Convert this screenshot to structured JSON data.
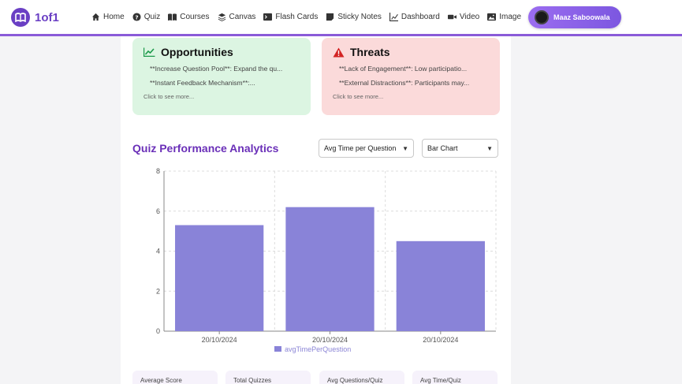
{
  "app": {
    "name": "1of1"
  },
  "nav": [
    {
      "label": "Home",
      "icon": "home-icon"
    },
    {
      "label": "Quiz",
      "icon": "question-icon"
    },
    {
      "label": "Courses",
      "icon": "book-icon"
    },
    {
      "label": "Canvas",
      "icon": "layers-icon"
    },
    {
      "label": "Flash Cards",
      "icon": "terminal-icon"
    },
    {
      "label": "Sticky Notes",
      "icon": "note-icon"
    },
    {
      "label": "Dashboard",
      "icon": "chart-icon"
    },
    {
      "label": "Video",
      "icon": "video-icon"
    },
    {
      "label": "Image",
      "icon": "image-icon"
    }
  ],
  "user": {
    "name": "Maaz Saboowala"
  },
  "swot": {
    "opportunities": {
      "title": "Opportunities",
      "items": [
        "**Increase Question Pool**: Expand the qu...",
        "**Instant Feedback Mechanism**:..."
      ],
      "more": "Click to see more..."
    },
    "threats": {
      "title": "Threats",
      "items": [
        "**Lack of Engagement**: Low participatio...",
        "**External Distractions**: Participants may..."
      ],
      "more": "Click to see more..."
    }
  },
  "analytics": {
    "title": "Quiz Performance Analytics",
    "metric_select": "Avg Time per Question",
    "chart_type_select": "Bar Chart"
  },
  "colors": {
    "accent": "#6a2fb8",
    "bar": "#8983d8",
    "opportunities_bg": "#dcf5e2",
    "threats_bg": "#fbdada"
  },
  "chart_data": {
    "type": "bar",
    "categories": [
      "20/10/2024",
      "20/10/2024",
      "20/10/2024"
    ],
    "series": [
      {
        "name": "avgTimePerQuestion",
        "values": [
          5.3,
          6.2,
          4.5
        ]
      }
    ],
    "ylim": [
      0,
      8
    ],
    "yticks": [
      0,
      2,
      4,
      6,
      8
    ],
    "grid": true,
    "legend": "bottom"
  },
  "stats": [
    "Average Score",
    "Total Quizzes",
    "Avg Questions/Quiz",
    "Avg Time/Quiz"
  ]
}
